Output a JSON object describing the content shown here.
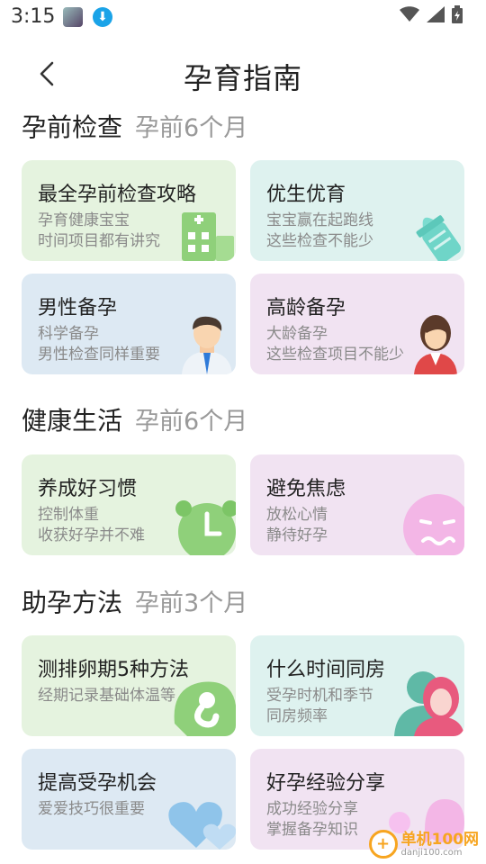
{
  "status": {
    "time": "3:15"
  },
  "header": {
    "title": "孕育指南"
  },
  "sections": [
    {
      "title": "孕前检查",
      "sub": "孕前6个月",
      "cards": [
        {
          "title": "最全孕前检查攻略",
          "desc1": "孕育健康宝宝",
          "desc2": "时间项目都有讲究"
        },
        {
          "title": "优生优育",
          "desc1": "宝宝赢在起跑线",
          "desc2": "这些检查不能少"
        },
        {
          "title": "男性备孕",
          "desc1": "科学备孕",
          "desc2": "男性检查同样重要"
        },
        {
          "title": "高龄备孕",
          "desc1": "大龄备孕",
          "desc2": "这些检查项目不能少"
        }
      ]
    },
    {
      "title": "健康生活",
      "sub": "孕前6个月",
      "cards": [
        {
          "title": "养成好习惯",
          "desc1": "控制体重",
          "desc2": "收获好孕并不难"
        },
        {
          "title": "避免焦虑",
          "desc1": "放松心情",
          "desc2": "静待好孕"
        }
      ]
    },
    {
      "title": "助孕方法",
      "sub": "孕前3个月",
      "cards": [
        {
          "title": "测排卵期5种方法",
          "desc1": "经期记录基础体温等",
          "desc2": ""
        },
        {
          "title": "什么时间同房",
          "desc1": "受孕时机和季节",
          "desc2": "同房频率"
        },
        {
          "title": "提高受孕机会",
          "desc1": "爱爱技巧很重要",
          "desc2": ""
        },
        {
          "title": "好孕经验分享",
          "desc1": "成功经验分享",
          "desc2": "掌握备孕知识"
        }
      ]
    }
  ],
  "watermark": {
    "name": "单机100网",
    "url": "danji100.com"
  },
  "colors": {
    "green": "#e5f3df",
    "teal": "#def2ef",
    "blue": "#dde9f3",
    "pink": "#f1e3f2"
  }
}
